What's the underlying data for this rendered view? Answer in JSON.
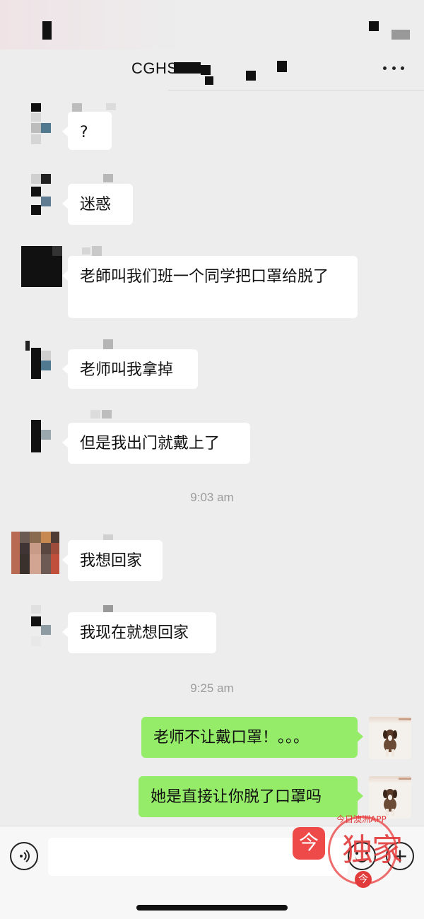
{
  "header": {
    "title": "CGHS",
    "more_icon": "more-dots-icon"
  },
  "messages": [
    {
      "direction": "incoming",
      "text": "?"
    },
    {
      "direction": "incoming",
      "text": "迷惑"
    },
    {
      "direction": "incoming",
      "text": "老師叫我们班一个同学把口罩给脱了"
    },
    {
      "direction": "incoming",
      "text": "老师叫我拿掉"
    },
    {
      "direction": "incoming",
      "text": "但是我出门就戴上了"
    },
    {
      "type": "timestamp",
      "text": "9:03 am"
    },
    {
      "direction": "incoming",
      "text": "我想回家"
    },
    {
      "direction": "incoming",
      "text": "我现在就想回家"
    },
    {
      "type": "timestamp",
      "text": "9:25 am"
    },
    {
      "direction": "outgoing",
      "text": "老师不让戴口罩！。。。"
    },
    {
      "direction": "outgoing",
      "text": "她是直接让你脱了口罩吗"
    }
  ],
  "input_bar": {
    "voice_icon": "voice-icon",
    "emoji_icon": "emoji-icon",
    "plus_icon": "plus-icon",
    "placeholder": ""
  },
  "watermark": {
    "logo_char": "今",
    "arc_text": "今日澳洲APP",
    "big_text": "独家",
    "bottom_char": "今"
  },
  "colors": {
    "background": "#ededed",
    "incoming_bubble": "#ffffff",
    "outgoing_bubble": "#95ec69",
    "timestamp": "#9b9b9b",
    "watermark_red": "#e23b3b"
  }
}
